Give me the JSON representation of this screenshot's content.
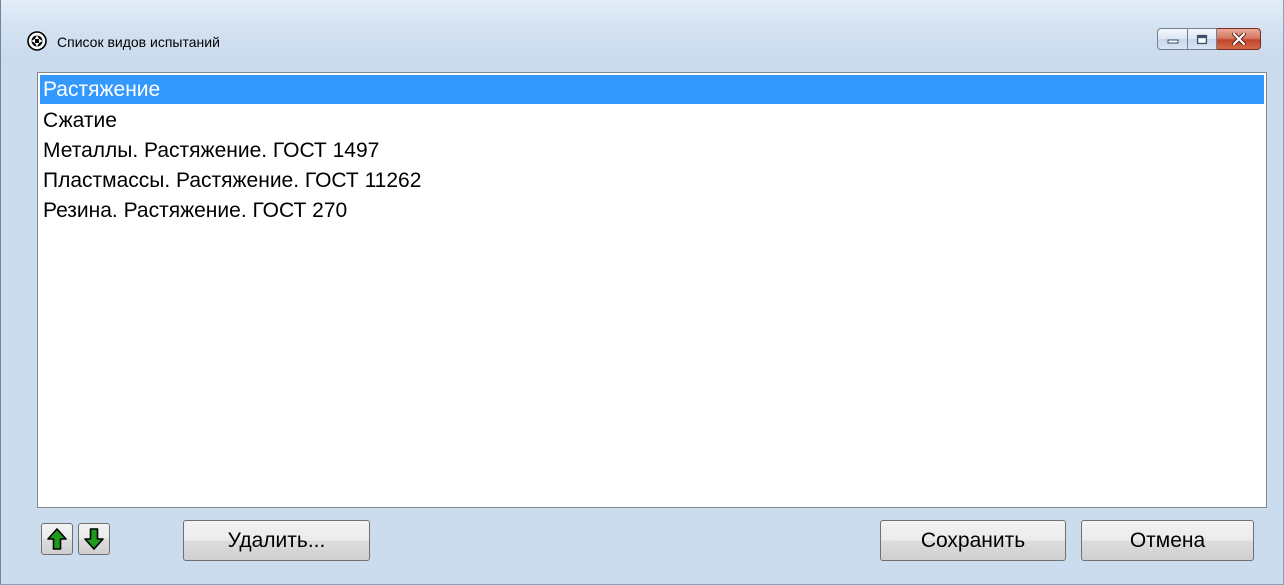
{
  "window": {
    "title": "Список видов испытаний",
    "icon": "app-cog-icon",
    "caption_buttons": [
      "minimize-icon",
      "maximize-icon",
      "close-icon"
    ]
  },
  "list": {
    "items": [
      {
        "label": "Растяжение",
        "selected": true
      },
      {
        "label": "Сжатие",
        "selected": false
      },
      {
        "label": "Металлы. Растяжение. ГОСТ 1497",
        "selected": false
      },
      {
        "label": "Пластмассы. Растяжение. ГОСТ 11262",
        "selected": false
      },
      {
        "label": "Резина. Растяжение. ГОСТ 270",
        "selected": false
      }
    ],
    "selection_color": "#3399ff"
  },
  "toolbar": {
    "move_up_icon": "green-arrow-up-icon",
    "move_down_icon": "green-arrow-down-icon",
    "delete_label": "Удалить...",
    "save_label": "Сохранить",
    "cancel_label": "Отмена"
  }
}
